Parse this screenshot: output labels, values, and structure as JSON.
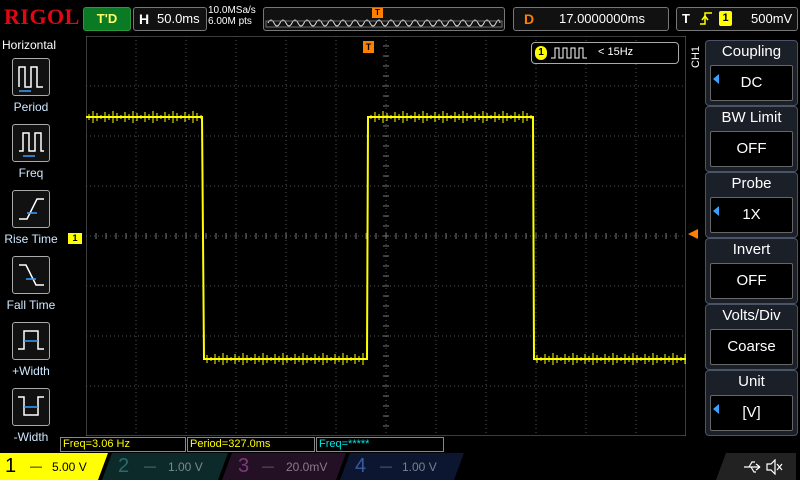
{
  "brand": "RIGOL",
  "status": "T'D",
  "horizontal": {
    "key": "H",
    "timebase": "50.0ms"
  },
  "sample": {
    "rate": "10.0MSa/s",
    "points": "6.00M pts"
  },
  "trigger_marker": "T",
  "delay": {
    "key": "D",
    "value": "17.0000000ms"
  },
  "trigger": {
    "key": "T",
    "source": "1",
    "level": "500mV"
  },
  "left_menu": {
    "title": "Horizontal",
    "items": [
      {
        "label": "Period",
        "icon": "period-icon"
      },
      {
        "label": "Freq",
        "icon": "freq-icon"
      },
      {
        "label": "Rise Time",
        "icon": "rise-time-icon"
      },
      {
        "label": "Fall Time",
        "icon": "fall-time-icon"
      },
      {
        "label": "+Width",
        "icon": "pos-width-icon"
      },
      {
        "label": "-Width",
        "icon": "neg-width-icon"
      }
    ]
  },
  "counter": {
    "channel": "1",
    "value": "< 15Hz"
  },
  "ch_label": "CH1",
  "channel_marker": "1",
  "right_menu": [
    {
      "title": "Coupling",
      "value": "DC"
    },
    {
      "title": "BW Limit",
      "value": "OFF"
    },
    {
      "title": "Probe",
      "value": "1X"
    },
    {
      "title": "Invert",
      "value": "OFF"
    },
    {
      "title": "Volts/Div",
      "value": "Coarse"
    },
    {
      "title": "Unit",
      "value": "[V]"
    }
  ],
  "measurements": [
    {
      "text": "Freq=3.06 Hz",
      "color": "#ffff00"
    },
    {
      "text": "Period=327.0ms",
      "color": "#ffff00"
    },
    {
      "text": "Freq=*****",
      "color": "#00e5e5"
    }
  ],
  "channels": [
    {
      "num": "1",
      "scale": "5.00 V",
      "color": "#ffff00",
      "active": true
    },
    {
      "num": "2",
      "scale": "1.00 V",
      "color": "#00c8c8",
      "active": false
    },
    {
      "num": "3",
      "scale": "20.0mV",
      "color": "#ff00ff",
      "active": false
    },
    {
      "num": "4",
      "scale": "1.00 V",
      "color": "#2060ff",
      "active": false
    }
  ],
  "colors": {
    "ch1": "#ffff00",
    "trigger": "#ff8000",
    "grid": "#555555",
    "menu_accent": "#3aa0ff"
  }
}
